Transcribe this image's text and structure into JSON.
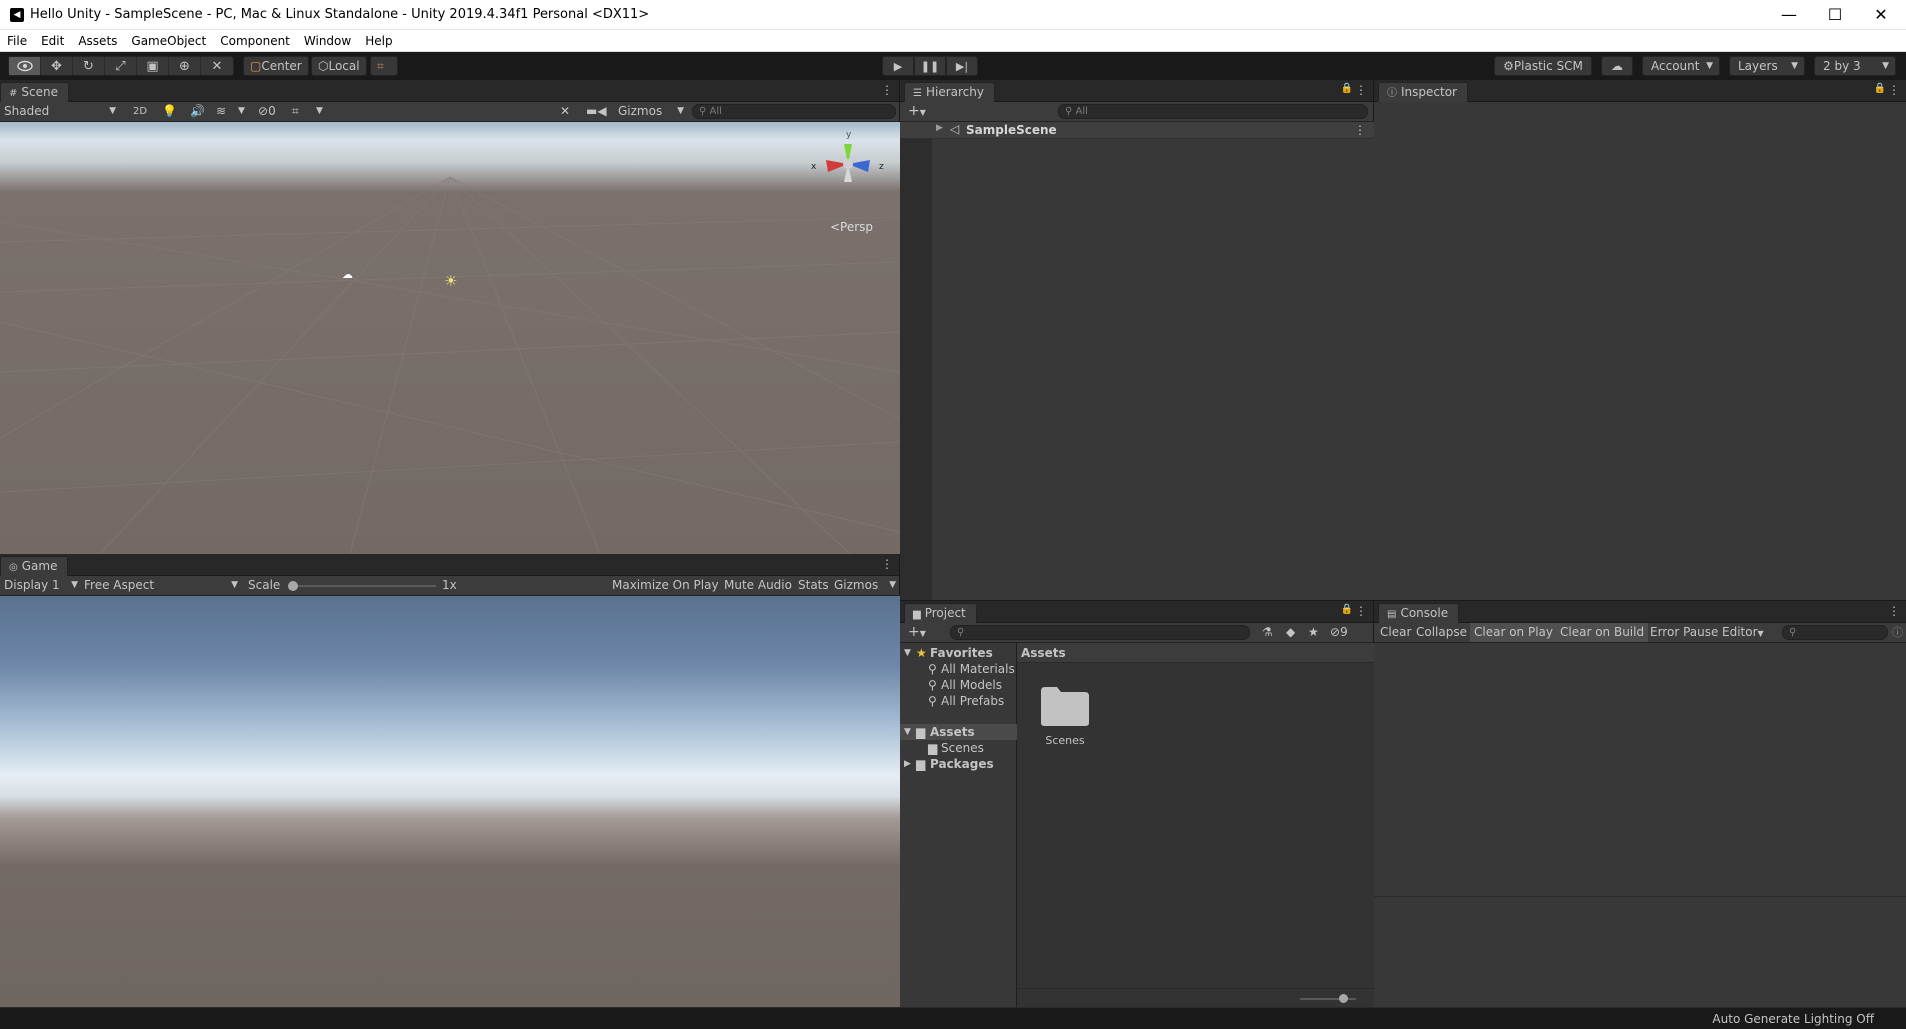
{
  "window": {
    "title": "Hello Unity - SampleScene - PC, Mac & Linux Standalone - Unity 2019.4.34f1 Personal <DX11>",
    "app_icon": "unity-logo-icon",
    "minimize": "—",
    "maximize": "☐",
    "close": "✕"
  },
  "menu": [
    "File",
    "Edit",
    "Assets",
    "GameObject",
    "Component",
    "Window",
    "Help"
  ],
  "toolbar": {
    "tools": [
      "view-tool-icon",
      "move-tool-icon",
      "rotate-tool-icon",
      "scale-tool-icon",
      "rect-tool-icon",
      "transform-tool-icon",
      "custom-tool-icon"
    ],
    "pivot": "Center",
    "space": "Local",
    "plastic_scm": "Plastic SCM",
    "account": "Account",
    "layers": "Layers",
    "layout": "2 by 3"
  },
  "scene": {
    "tab": "Scene",
    "draw_mode": "Shaded",
    "mode_2d": "2D",
    "hidden_count": "0",
    "gizmos": "Gizmos",
    "search_placeholder": "All",
    "persp_label": "<Persp",
    "axis_x": "x",
    "axis_y": "y",
    "axis_z": "z"
  },
  "game": {
    "tab": "Game",
    "display": "Display 1",
    "aspect": "Free Aspect",
    "scale_label": "Scale",
    "scale_value": "1x",
    "maximize_on_play": "Maximize On Play",
    "mute_audio": "Mute Audio",
    "stats": "Stats",
    "gizmos": "Gizmos"
  },
  "hierarchy": {
    "tab": "Hierarchy",
    "search_placeholder": "All",
    "scene_name": "SampleScene"
  },
  "inspector": {
    "tab": "Inspector"
  },
  "project": {
    "tab": "Project",
    "hidden_count": "9",
    "favorites": "Favorites",
    "fav_items": [
      "All Materials",
      "All Models",
      "All Prefabs"
    ],
    "assets_root": "Assets",
    "assets_children": [
      "Scenes"
    ],
    "packages": "Packages",
    "breadcrumb": "Assets",
    "folder_label": "Scenes"
  },
  "console": {
    "tab": "Console",
    "clear": "Clear",
    "collapse": "Collapse",
    "clear_on_play": "Clear on Play",
    "clear_on_build": "Clear on Build",
    "error_pause": "Error Pause",
    "editor": "Editor"
  },
  "status": {
    "text": "Auto Generate Lighting Off"
  }
}
